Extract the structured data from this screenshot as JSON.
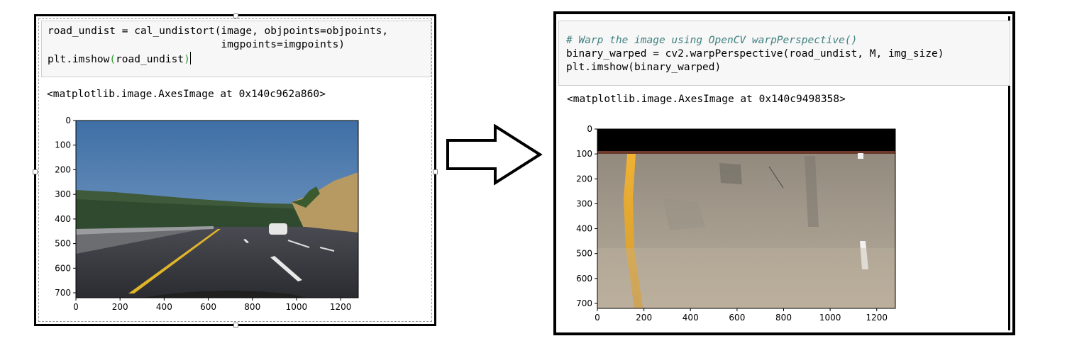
{
  "left_cell": {
    "code_line1": "road_undist = cal_undistort(image, objpoints=objpoints,",
    "code_line2": "                            imgpoints=imgpoints)",
    "code_line3_pre": "plt.imshow",
    "code_line3_open": "(",
    "code_line3_arg": "road_undist",
    "code_line3_close": ")",
    "output": "<matplotlib.image.AxesImage at 0x140c962a860>",
    "y_ticks": [
      "0",
      "100",
      "200",
      "300",
      "400",
      "500",
      "600",
      "700"
    ],
    "x_ticks": [
      "0",
      "200",
      "400",
      "600",
      "800",
      "1000",
      "1200"
    ]
  },
  "right_cell": {
    "comment": "# Warp the image using OpenCV warpPerspective()",
    "code_line2": "binary_warped = cv2.warpPerspective(road_undist, M, img_size)",
    "code_line3": "plt.imshow(binary_warped)",
    "output": "<matplotlib.image.AxesImage at 0x140c9498358>",
    "y_ticks": [
      "0",
      "100",
      "200",
      "300",
      "400",
      "500",
      "600",
      "700"
    ],
    "x_ticks": [
      "0",
      "200",
      "400",
      "600",
      "800",
      "1000",
      "1200"
    ]
  },
  "arrow": {
    "icon": "right-arrow-icon"
  },
  "colors": {
    "input_bg": "#f7f7f7",
    "comment": "#408080",
    "paren_match": "#2c9e2c"
  }
}
